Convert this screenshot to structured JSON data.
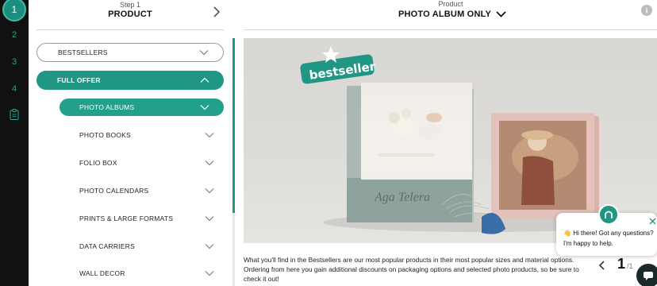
{
  "steps": {
    "active": "1",
    "items": [
      "2",
      "3",
      "4"
    ]
  },
  "step_header": {
    "label": "Step 1",
    "title": "PRODUCT"
  },
  "product_header": {
    "label": "Product",
    "title": "PHOTO ALBUM ONLY",
    "info": "i"
  },
  "menu": {
    "bestsellers": "BESTSELLERS",
    "full_offer": "FULL OFFER",
    "sub_active": "PHOTO ALBUMS",
    "items": [
      "PHOTO BOOKS",
      "FOLIO BOX",
      "PHOTO CALENDARS",
      "PRINTS & LARGE FORMATS",
      "DATA CARRIERS",
      "WALL DECOR"
    ]
  },
  "hero": {
    "badge": "bestseller",
    "album_signature": "Aga Telera"
  },
  "caption": "What you'll find in the Bestsellers are our most popular products in their most popular sizes and material options. Ordering from here you gain additional discounts on packaging options and selected photo products, so be sure to check it out!",
  "pager": {
    "current": "1",
    "total": "/1"
  },
  "chat": {
    "greeting_line1": "Hi there! Got any questions?",
    "greeting_line2": "I'm happy to help."
  },
  "colors": {
    "accent": "#1f9784",
    "rail": "#111111"
  }
}
